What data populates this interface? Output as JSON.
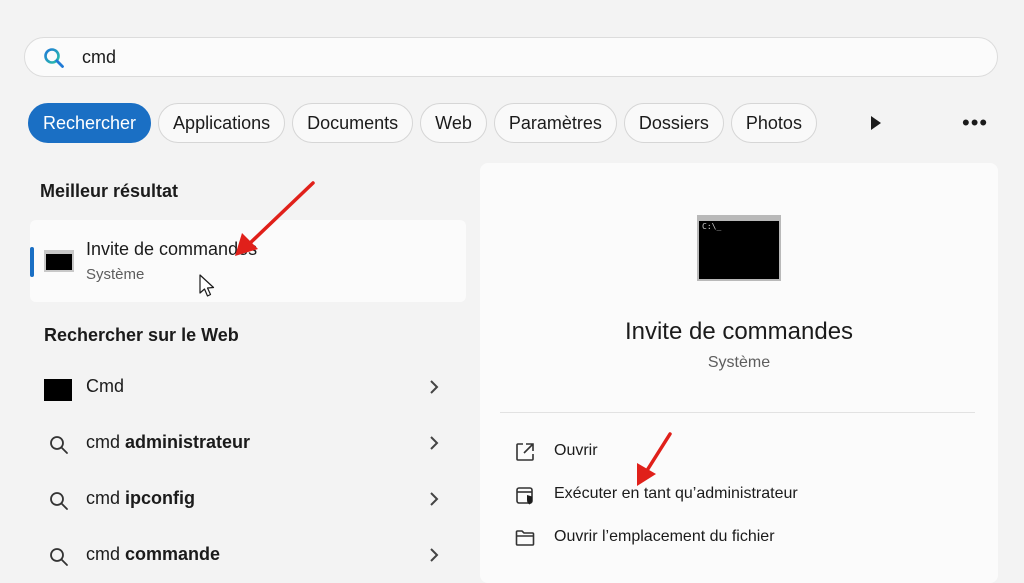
{
  "search": {
    "value": "cmd"
  },
  "filters": {
    "chips": [
      "Rechercher",
      "Applications",
      "Documents",
      "Web",
      "Paramètres",
      "Dossiers",
      "Photos"
    ],
    "active_index": 0
  },
  "best_match": {
    "heading": "Meilleur résultat",
    "title": "Invite de commandes",
    "subtitle": "Système"
  },
  "web": {
    "heading": "Rechercher sur le Web",
    "items": [
      {
        "prefix": "Cmd",
        "bold": "",
        "icon": "cmd-icon"
      },
      {
        "prefix": "cmd ",
        "bold": "administrateur",
        "icon": "search-icon"
      },
      {
        "prefix": "cmd ",
        "bold": "ipconfig",
        "icon": "search-icon"
      },
      {
        "prefix": "cmd ",
        "bold": "commande",
        "icon": "search-icon"
      }
    ]
  },
  "detail": {
    "title": "Invite de commandes",
    "subtitle": "Système",
    "icon_text": "C:\\_",
    "actions": [
      {
        "label": "Ouvrir",
        "icon": "open-external-icon"
      },
      {
        "label": "Exécuter en tant qu’administrateur",
        "icon": "shield-icon"
      },
      {
        "label": "Ouvrir l’emplacement du fichier",
        "icon": "folder-icon"
      }
    ]
  },
  "colors": {
    "accent": "#1a6fc4",
    "annotation_arrow": "#e0201a"
  }
}
